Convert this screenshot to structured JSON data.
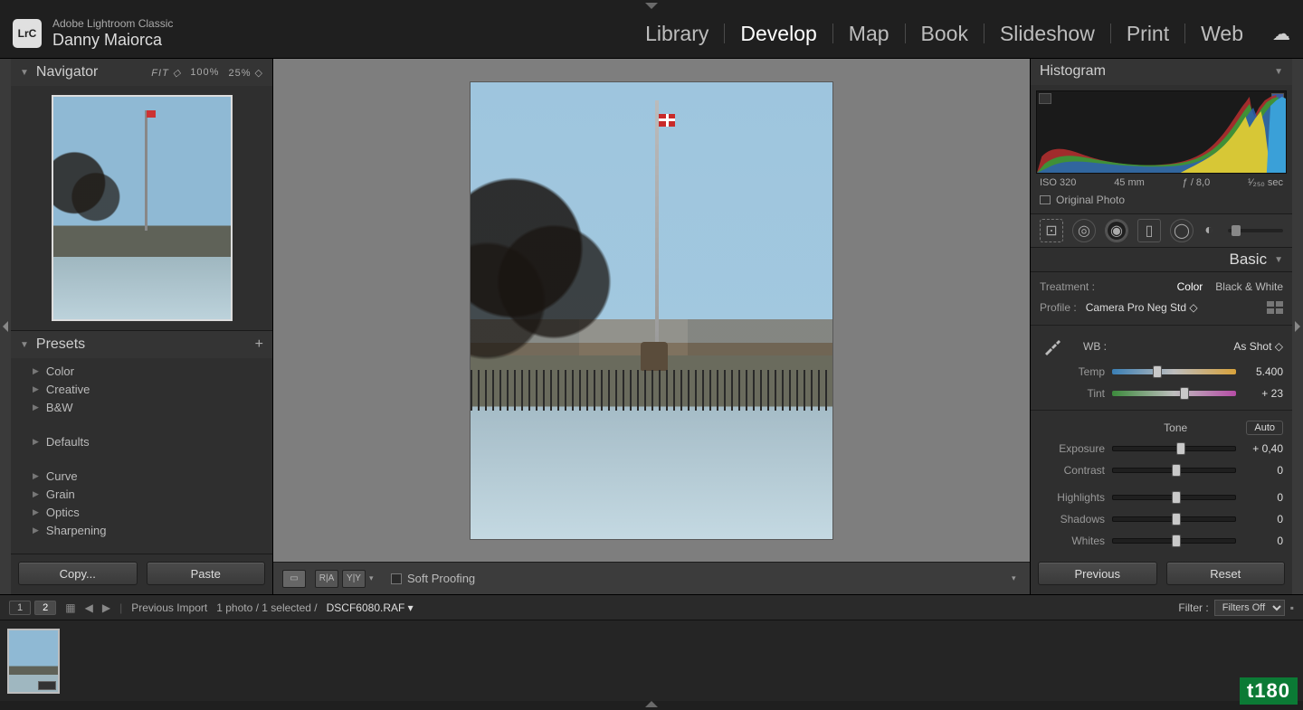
{
  "header": {
    "app_name": "Adobe Lightroom Classic",
    "user": "Danny Maiorca",
    "logo_text": "LrC",
    "modules": [
      "Library",
      "Develop",
      "Map",
      "Book",
      "Slideshow",
      "Print",
      "Web"
    ],
    "active_module": "Develop"
  },
  "navigator": {
    "title": "Navigator",
    "zoom_fit": "FIT",
    "zoom_100": "100%",
    "zoom_25": "25%"
  },
  "presets": {
    "title": "Presets",
    "groups": [
      "Color",
      "Creative",
      "B&W"
    ],
    "groups2": [
      "Defaults"
    ],
    "groups3": [
      "Curve",
      "Grain",
      "Optics",
      "Sharpening"
    ]
  },
  "left_buttons": {
    "copy": "Copy...",
    "paste": "Paste"
  },
  "center_toolbar": {
    "soft_proofing": "Soft Proofing"
  },
  "histogram": {
    "title": "Histogram",
    "iso": "ISO 320",
    "focal": "45 mm",
    "aperture": "ƒ / 8,0",
    "shutter": "¹⁄₂₅₀ sec",
    "original": "Original Photo"
  },
  "basic": {
    "title": "Basic",
    "treatment_label": "Treatment :",
    "treatment_color": "Color",
    "treatment_bw": "Black & White",
    "profile_label": "Profile :",
    "profile_value": "Camera Pro Neg Std",
    "wb_label": "WB :",
    "wb_value": "As Shot",
    "temp_label": "Temp",
    "temp_value": "5.400",
    "tint_label": "Tint",
    "tint_value": "+ 23",
    "tone_label": "Tone",
    "auto": "Auto",
    "exposure_label": "Exposure",
    "exposure_value": "+ 0,40",
    "contrast_label": "Contrast",
    "contrast_value": "0",
    "highlights_label": "Highlights",
    "highlights_value": "0",
    "shadows_label": "Shadows",
    "shadows_value": "0",
    "whites_label": "Whites",
    "whites_value": "0"
  },
  "right_buttons": {
    "previous": "Previous",
    "reset": "Reset"
  },
  "filmstrip": {
    "view1": "1",
    "view2": "2",
    "source": "Previous Import",
    "count": "1 photo / 1 selected /",
    "filename": "DSCF6080.RAF",
    "filter_label": "Filter :",
    "filter_value": "Filters Off"
  },
  "watermark": "t180"
}
